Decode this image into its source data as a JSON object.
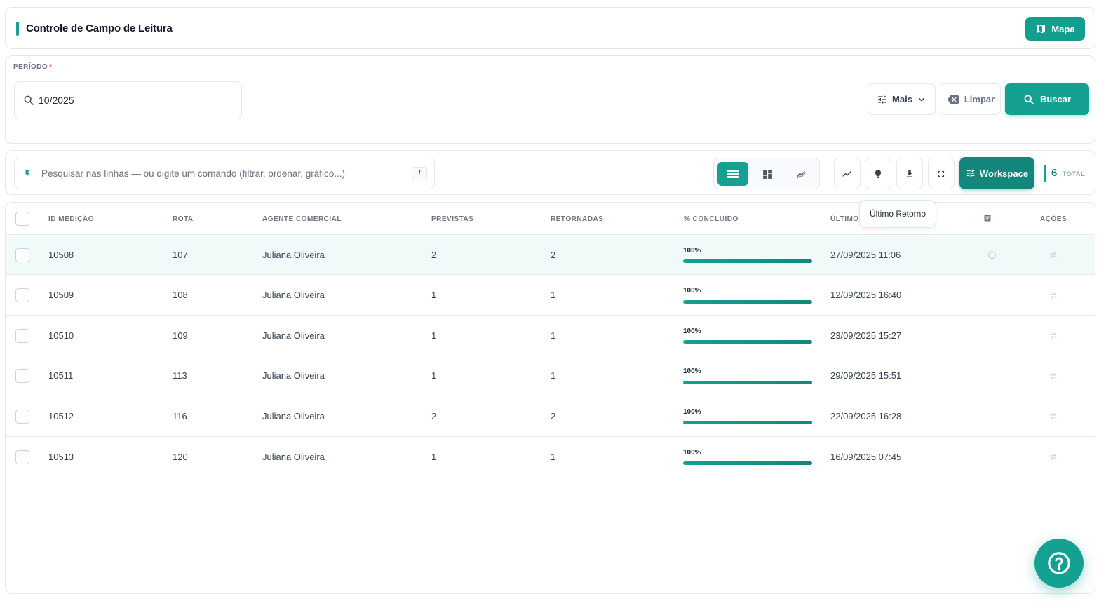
{
  "header": {
    "title": "Controle de Campo de Leitura",
    "map_button": "Mapa"
  },
  "filter": {
    "period_label": "PERÍODO",
    "required_mark": "*",
    "period_value": "10/2025",
    "more_button": "Mais",
    "clear_button": "Limpar",
    "search_button": "Buscar"
  },
  "toolbar": {
    "command_placeholder": "Pesquisar nas linhas — ou digite um comando (filtrar, ordenar, gráfico...)",
    "shortcut_key": "/",
    "view_modes": [
      "list-icon",
      "grid-icon",
      "chart-line-icon"
    ],
    "active_view": "list",
    "workspace_button": "Workspace",
    "total_count": "6",
    "total_label": "TOTAL"
  },
  "table": {
    "columns": {
      "id": "ID MEDIÇÃO",
      "route": "ROTA",
      "agent": "AGENTE COMERCIAL",
      "expected": "PREVISTAS",
      "returned": "RETORNADAS",
      "completed": "% CONCLUÍDO",
      "last": "ÚLTIMO",
      "actions": "AÇÕES"
    },
    "rows": [
      {
        "id": "10508",
        "route": "107",
        "agent": "Juliana Oliveira",
        "expected": "2",
        "returned": "2",
        "pct": "100%",
        "pct_value": 100,
        "last_return": "27/09/2025 11:06"
      },
      {
        "id": "10509",
        "route": "108",
        "agent": "Juliana Oliveira",
        "expected": "1",
        "returned": "1",
        "pct": "100%",
        "pct_value": 100,
        "last_return": "12/09/2025 16:40"
      },
      {
        "id": "10510",
        "route": "109",
        "agent": "Juliana Oliveira",
        "expected": "1",
        "returned": "1",
        "pct": "100%",
        "pct_value": 100,
        "last_return": "23/09/2025 15:27"
      },
      {
        "id": "10511",
        "route": "113",
        "agent": "Juliana Oliveira",
        "expected": "1",
        "returned": "1",
        "pct": "100%",
        "pct_value": 100,
        "last_return": "29/09/2025 15:51"
      },
      {
        "id": "10512",
        "route": "116",
        "agent": "Juliana Oliveira",
        "expected": "2",
        "returned": "2",
        "pct": "100%",
        "pct_value": 100,
        "last_return": "22/09/2025 16:28"
      },
      {
        "id": "10513",
        "route": "120",
        "agent": "Juliana Oliveira",
        "expected": "1",
        "returned": "1",
        "pct": "100%",
        "pct_value": 100,
        "last_return": "16/09/2025 07:45"
      }
    ]
  },
  "tooltip": "Último Retorno",
  "colors": {
    "accent": "#14a192",
    "accent_dark": "#13877c",
    "highlight_row": "#f0faf8",
    "required": "#dc2626"
  }
}
